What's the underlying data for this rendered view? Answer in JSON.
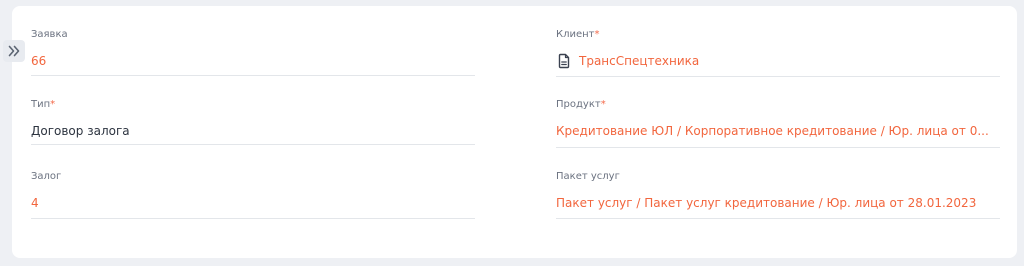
{
  "fields": {
    "application": {
      "label": "Заявка",
      "value": "66"
    },
    "type": {
      "label": "Тип",
      "required_mark": "*",
      "value": "Договор залога"
    },
    "collateral": {
      "label": "Залог",
      "value": "4"
    },
    "client": {
      "label": "Клиент",
      "required_mark": "*",
      "value": "ТрансСпецтехника",
      "icon": "document-icon"
    },
    "product": {
      "label": "Продукт",
      "required_mark": "*",
      "value": "Кредитование ЮЛ / Корпоративное кредитование / Юр. лица от 0..."
    },
    "service_package": {
      "label": "Пакет услуг",
      "value": "Пакет услуг / Пакет услуг кредитование / Юр. лица от 28.01.2023"
    }
  },
  "icons": {
    "collapse": "double-chevron-right-icon"
  },
  "colors": {
    "accent": "#f2663e",
    "text": "#2d3440",
    "label": "#6b7280",
    "divider": "#e3e6ea"
  }
}
